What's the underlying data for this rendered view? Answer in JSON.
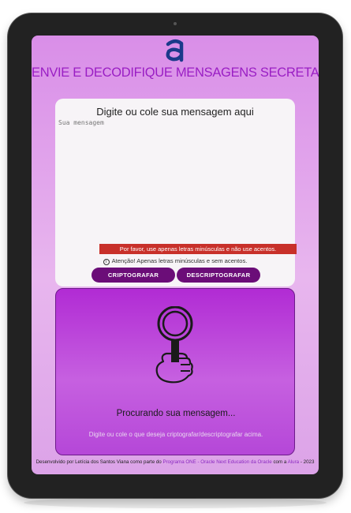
{
  "app": {
    "headline": "ENVIE E DECODIFIQUE MENSAGENS SECRETAS!",
    "logo_icon": "alura-logo-icon"
  },
  "input": {
    "title": "Digite ou cole sua mensagem aqui",
    "placeholder": "Sua mensagem",
    "value": "",
    "error": "Por favor, use apenas letras minúsculas e não use acentos.",
    "warning": "Atenção! Apenas letras minúsculas e sem acentos.",
    "warning_icon": "info-icon"
  },
  "actions": {
    "encrypt_label": "CRIPTOGRAFAR",
    "decrypt_label": "DESCRIPTOGRAFAR"
  },
  "output": {
    "illustration": "magnifying-glass-hand-icon",
    "title": "Procurando sua mensagem...",
    "description": "Digite ou cole o que deseja criptografar/descriptografar acima."
  },
  "footer": {
    "text_1": "Desenvolvido por Letícia dos Santos Viana como parte do ",
    "link_program": "Programa ONE - Oracle Next Education da Oracle",
    "text_2": " com a ",
    "link_alura": "Alura",
    "text_3": " - 2023",
    "icons": [
      "linkedin-icon",
      "github-icon"
    ]
  },
  "colors": {
    "accent": "#9a1ec4",
    "button": "#6b0d78",
    "error": "#c8302a",
    "output_bg": "#b12bd4"
  }
}
